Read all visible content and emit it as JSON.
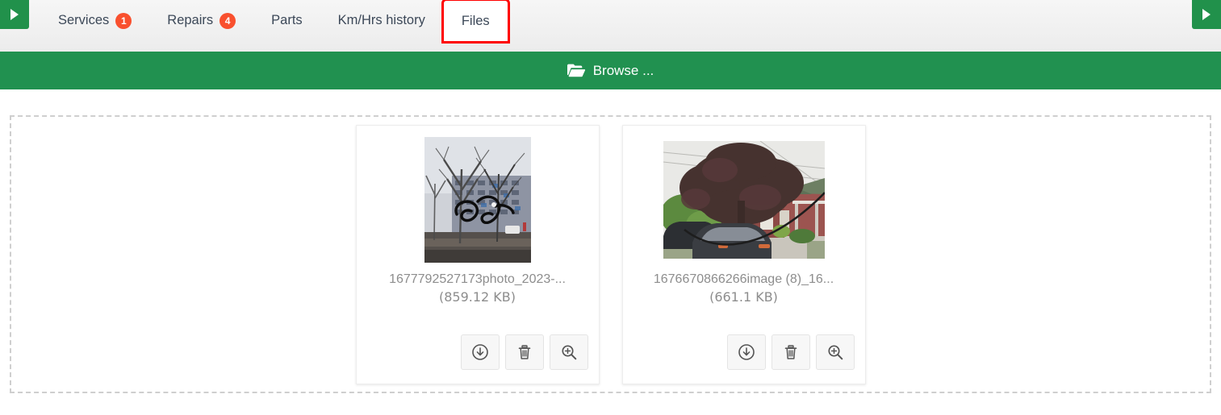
{
  "nav": {
    "scroll_left_icon": "triangle-right-icon",
    "scroll_right_icon": "triangle-right-icon"
  },
  "tabs": [
    {
      "label": "Services",
      "badge": "1",
      "active": false,
      "annotated": false
    },
    {
      "label": "Repairs",
      "badge": "4",
      "active": false,
      "annotated": false
    },
    {
      "label": "Parts",
      "badge": null,
      "active": false,
      "annotated": false
    },
    {
      "label": "Km/Hrs history",
      "badge": null,
      "active": false,
      "annotated": false
    },
    {
      "label": "Files",
      "badge": null,
      "active": true,
      "annotated": true
    }
  ],
  "browse": {
    "label": "Browse ...",
    "icon": "open-folder-icon"
  },
  "files": [
    {
      "name": "1677792527173photo_2023-...",
      "size": "(859.12  KB)",
      "thumb_alt": "winter street with bare trees and apartment block, black scribble",
      "actions": [
        {
          "name": "download-button",
          "icon": "download-circle-icon"
        },
        {
          "name": "delete-button",
          "icon": "trash-icon"
        },
        {
          "name": "preview-button",
          "icon": "zoom-in-icon"
        }
      ]
    },
    {
      "name": "1676670866266image (8)_16...",
      "size": "(661.1  KB)",
      "thumb_alt": "purple-leaf tree in front of red brick house with parked cars",
      "actions": [
        {
          "name": "download-button",
          "icon": "download-circle-icon"
        },
        {
          "name": "delete-button",
          "icon": "trash-icon"
        },
        {
          "name": "preview-button",
          "icon": "zoom-in-icon"
        }
      ]
    }
  ],
  "colors": {
    "brand_green": "#219150",
    "badge_red": "#f9502e",
    "annotation_red": "#ff0000",
    "tab_text": "#3c4858",
    "muted_text": "#8d8d8d"
  }
}
